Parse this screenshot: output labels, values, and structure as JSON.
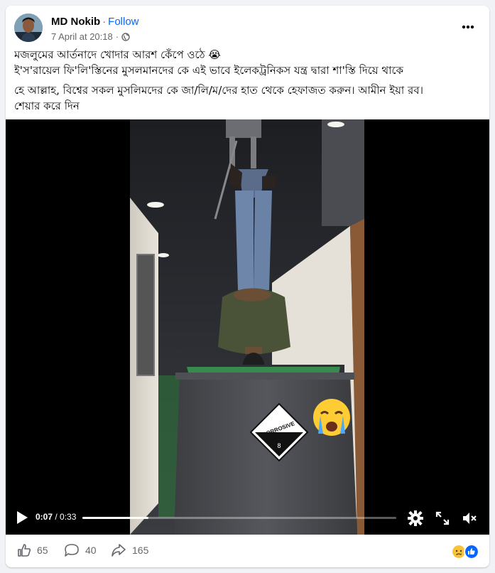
{
  "post": {
    "author": "MD Nokib",
    "separator": "·",
    "follow_label": "Follow",
    "timestamp": "7 April at 20:18",
    "separator2": "·",
    "privacy_icon": "globe-icon",
    "more_icon": "more-horizontal-icon",
    "text": {
      "line1": "মজলুমের আর্তনাদে খোদার আরশ কেঁপে ওঠে 😭",
      "line2": "ই'স'রায়েল ফি'লি'স্তিনের মুসলমানদের কে এই ভাবে ইলেকট্রনিকস যন্ত্র দ্বারা শা'স্তি দিয়ে থাকে",
      "line3": "হে আল্লাহ, বিশ্বের সকল মুসলিমদের কে জা/লি/ম/দের হাত থেকে  হেফাজত করুন। আমীন ইয়া রব।",
      "line4": "শেয়ার করে দিন"
    }
  },
  "video": {
    "current_time": "0:07",
    "separator": " / ",
    "duration": "0:33",
    "progress": 0.21,
    "sign_text": "CORROSIVE",
    "sign_number": "8",
    "icons": [
      "play-icon",
      "settings-icon",
      "fullscreen-icon",
      "mute-icon"
    ],
    "overlay_emoji": "crying-face-emoji"
  },
  "footer": {
    "likes": "65",
    "comments": "40",
    "shares": "165",
    "icons": [
      "like-icon",
      "comment-icon",
      "share-icon"
    ],
    "reactions": [
      "sad-reaction-icon",
      "like-reaction-icon"
    ]
  },
  "colors": {
    "accent": "#0866ff",
    "secondary_text": "#65676b",
    "background": "#f0f2f5",
    "card": "#ffffff"
  }
}
